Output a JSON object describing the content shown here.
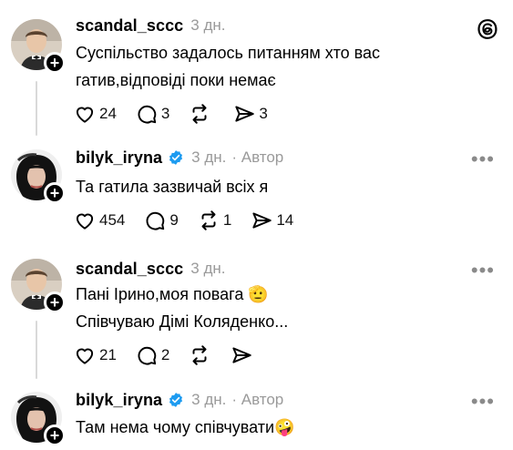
{
  "app": {
    "logo_icon": "threads-logo-icon"
  },
  "posts": [
    {
      "username": "scandal_sccc",
      "time": "3 дн.",
      "author_tag": "",
      "verified": false,
      "text_lines": [
        "Суспільство задалось питанням хто вас",
        "гатив,відповіді поки немає"
      ],
      "likes": "24",
      "replies": "3",
      "reposts": "",
      "shares": "3"
    },
    {
      "username": "bilyk_iryna",
      "time": "3 дн.",
      "author_tag": "· Автор",
      "verified": true,
      "text_lines": [
        "Та гатила зазвичай всіх я"
      ],
      "likes": "454",
      "replies": "9",
      "reposts": "1",
      "shares": "14"
    },
    {
      "username": "scandal_sccc",
      "time": "3 дн.",
      "author_tag": "",
      "verified": false,
      "text_lines": [
        "Пані Ірино,моя повага 🫡",
        "Співчуваю Дімі Коляденко..."
      ],
      "likes": "21",
      "replies": "2",
      "reposts": "",
      "shares": ""
    },
    {
      "username": "bilyk_iryna",
      "time": "3 дн.",
      "author_tag": "· Автор",
      "verified": true,
      "text_lines": [
        "Там нема чому співчувати🤪"
      ]
    }
  ],
  "more_menu": "•••",
  "colors": {
    "verified": "#1d9bf0",
    "muted": "#9a9a9a",
    "line": "#d9d9d9"
  }
}
